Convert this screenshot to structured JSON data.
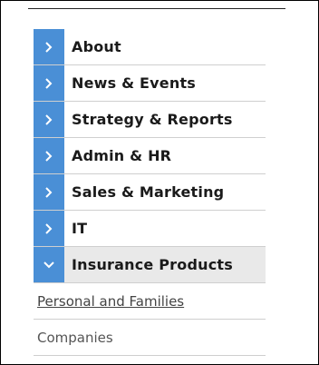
{
  "nav": {
    "items": [
      {
        "label": "About",
        "icon": "chevron-right-icon"
      },
      {
        "label": "News & Events",
        "icon": "chevron-right-icon"
      },
      {
        "label": "Strategy & Reports",
        "icon": "chevron-right-icon"
      },
      {
        "label": "Admin & HR",
        "icon": "chevron-right-icon"
      },
      {
        "label": "Sales & Marketing",
        "icon": "chevron-right-icon"
      },
      {
        "label": "IT",
        "icon": "chevron-right-icon"
      },
      {
        "label": "Insurance Products",
        "icon": "chevron-down-icon",
        "expanded": true
      }
    ],
    "subitems": [
      {
        "label": "Personal and Families"
      },
      {
        "label": "Companies"
      }
    ]
  },
  "colors": {
    "accent": "#4a8fd6",
    "active_bg": "#e9e9e9",
    "divider": "#cfcfcf"
  }
}
